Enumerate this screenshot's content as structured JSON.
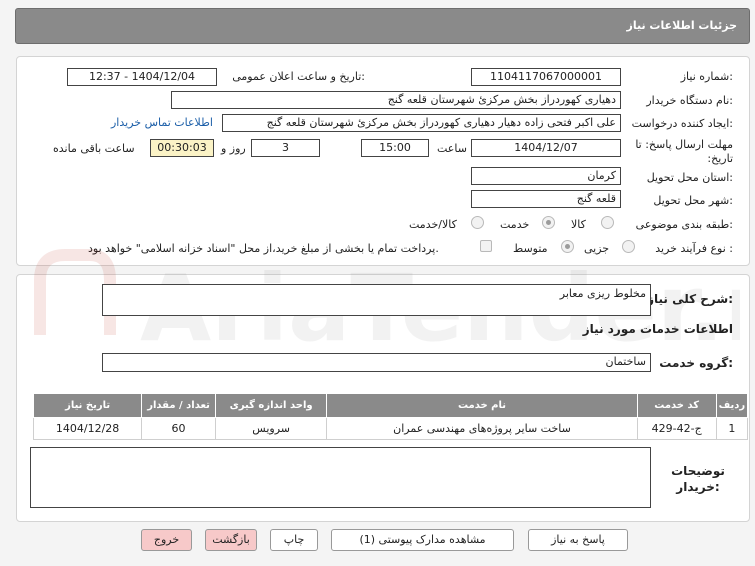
{
  "header": {
    "title": "جزئیات اطلاعات نیاز"
  },
  "form": {
    "need_number_label": "شماره نیاز:",
    "need_number": "1104117067000001",
    "announce_label": "تاریخ و ساعت اعلان عمومی:",
    "announce_value": "1404/12/04 - 12:37",
    "buyer_org_label": "نام دستگاه خریدار:",
    "buyer_org": "دهیاری کهوردراز بخش مرکزئ شهرستان قلعه گنج",
    "creator_label": "ایجاد کننده درخواست:",
    "creator": "علی اکبر فتحی زاده دهیار دهیاری کهوردراز بخش مرکزئ شهرستان قلعه گنج",
    "contact_link": "اطلاعات تماس خریدار",
    "deadline_label": "مهلت ارسال پاسخ: تا تاریخ:",
    "deadline_date": "1404/12/07",
    "time_label": "ساعت",
    "deadline_time": "15:00",
    "days_value": "3",
    "days_label": "روز و",
    "remaining_time": "00:30:03",
    "remaining_label": "ساعت باقی مانده",
    "province_label": "استان محل تحویل:",
    "province": "کرمان",
    "city_label": "شهر محل تحویل:",
    "city": "قلعه گنج",
    "category_label": "طبقه بندی موضوعی:",
    "category_options": [
      "کالا",
      "خدمت",
      "کالا/خدمت"
    ],
    "process_label": "نوع فرآیند خرید :",
    "process_options": [
      "جزیی",
      "متوسط"
    ],
    "payment_note": "پرداخت تمام یا بخشی از مبلغ خرید،از محل \"اسناد خزانه اسلامی\" خواهد بود."
  },
  "summary": {
    "label": "شرح کلی نیاز:",
    "value": "مخلوط ریزی معابر"
  },
  "services": {
    "section_title": "اطلاعات خدمات مورد نیاز",
    "group_label": "گروه خدمت:",
    "group_value": "ساختمان",
    "columns": [
      "ردیف",
      "کد خدمت",
      "نام خدمت",
      "واحد اندازه گیری",
      "تعداد / مقدار",
      "تاریخ نیاز"
    ],
    "rows": [
      [
        "1",
        "ج-42-429",
        "ساخت سایر پروژه‌های مهندسی عمران",
        "سرویس",
        "60",
        "1404/12/28"
      ]
    ]
  },
  "buyer_notes": {
    "label": "توضیحات خریدار:",
    "value": ""
  },
  "buttons": {
    "reply": "پاسخ به نیاز",
    "attachments": "مشاهده مدارک پیوستی (1)",
    "print": "چاپ",
    "back": "بازگشت",
    "exit": "خروج"
  },
  "watermark": {
    "text": "AriaTender.net"
  }
}
